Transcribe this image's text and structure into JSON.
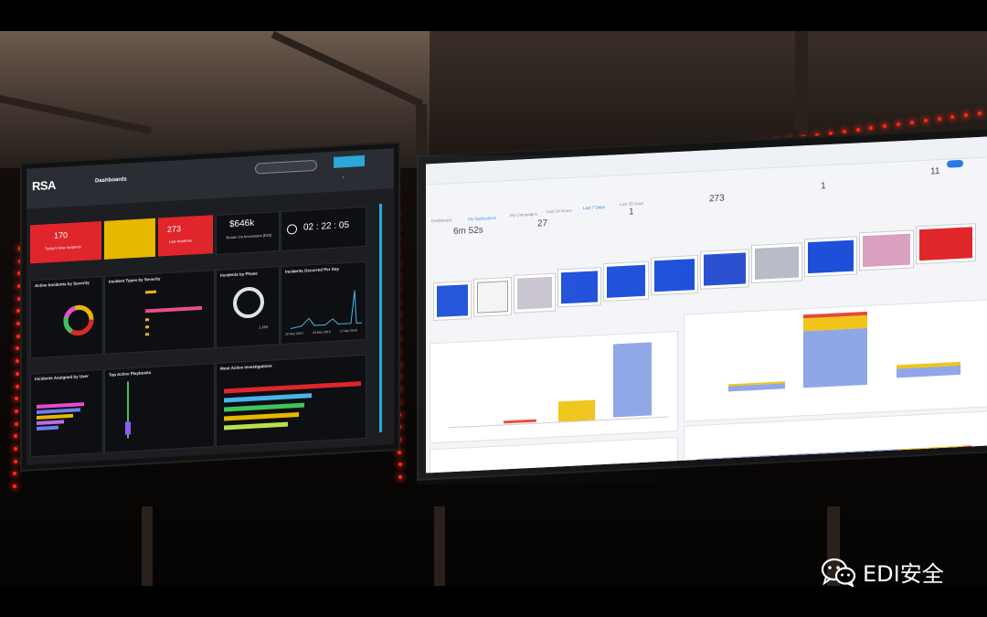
{
  "left_screen": {
    "logo": "RSA",
    "title": "Dashboards",
    "kpis": [
      {
        "value": "170",
        "color": "#e0262a"
      },
      {
        "value": "",
        "color": "#e6b800"
      },
      {
        "value": "273",
        "color": "#e0262a"
      },
      {
        "value": "$646k",
        "color": ""
      },
      {
        "value": "02 : 22 : 05",
        "color": ""
      }
    ],
    "kpi_labels": [
      "Today's New Incidents",
      "",
      "Late Incidents",
      "Return On Investment (ROI)",
      ""
    ],
    "panels": {
      "active_by_severity": "Active Incidents by Severity",
      "types_by_severity": "Incident Types by Severity",
      "by_phase": "Incidents by Phase",
      "per_day": "Incidents Occurred Per Day",
      "assigned_by_user": "Incidents Assigned by User",
      "playbooks": "Top Active Playbooks",
      "investigations": "Most Active Investigations"
    },
    "per_day_dates": [
      "16 Mar 2019",
      "29 Mar 2019",
      "17 Apr 2019"
    ],
    "phase_count": "1,154"
  },
  "right_screen": {
    "tabs": [
      "Dashboard",
      "My Applications",
      "My Campaigns",
      "Last 24 Hours",
      "Last 7 Days",
      "Last 30 Days"
    ],
    "stats": [
      {
        "value": "6m 52s"
      },
      {
        "value": "27"
      },
      {
        "value": "273"
      },
      {
        "value": "1"
      },
      {
        "value": "1"
      },
      {
        "value": "11"
      }
    ]
  },
  "watermark": {
    "text": "EDI安全"
  },
  "colors": {
    "accent_blue": "#2aa8d8",
    "bar_blue": "#8fa7e6",
    "bar_yellow": "#f0c419",
    "bar_red": "#e64a3b",
    "led_red": "#ff2a1a"
  }
}
